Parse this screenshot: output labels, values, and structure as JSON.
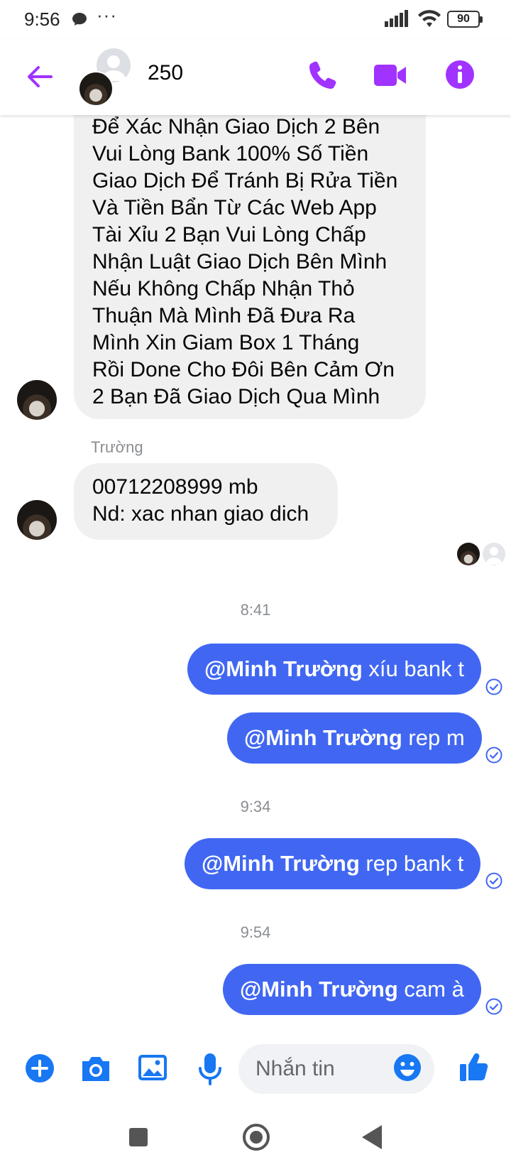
{
  "status_bar": {
    "time": "9:56",
    "more": "···",
    "battery": "90"
  },
  "header": {
    "title": "250",
    "accent_color": "#a033ff"
  },
  "messages": {
    "long_text_lines": [
      "Để Xác Nhận Giao Dịch 2 Bên",
      "Vui Lòng Bank 100% Số Tiền",
      "Giao Dịch Để Tránh Bị Rửa Tiền",
      "Và Tiền Bẩn Từ Các Web App",
      "Tài Xỉu 2 Bạn Vui Lòng Chấp",
      "Nhận Luật Giao Dịch Bên Mình",
      "Nếu Không Chấp Nhận Thỏ",
      "Thuận Mà Mình Đã Đưa Ra",
      "Mình Xin Giam Box 1 Tháng",
      "Rồi Done Cho Đôi Bên Cảm Ơn",
      "2 Bạn Đã Giao Dịch Qua Mình"
    ],
    "sender_name": "Trường",
    "bank_line1": "00712208999 mb",
    "bank_line2": "Nd: xac nhan giao dich",
    "time_1": "8:41",
    "time_2": "9:34",
    "time_3": "9:54",
    "outgoing": [
      {
        "mention": "@Minh Trường",
        "text": " xíu bank t"
      },
      {
        "mention": "@Minh Trường",
        "text": " rep m"
      },
      {
        "mention": "@Minh Trường",
        "text": " rep bank t"
      },
      {
        "mention": "@Minh Trường",
        "text": " cam à"
      }
    ],
    "outgoing_color": "#4167f2"
  },
  "composer": {
    "placeholder": "Nhắn tin"
  }
}
